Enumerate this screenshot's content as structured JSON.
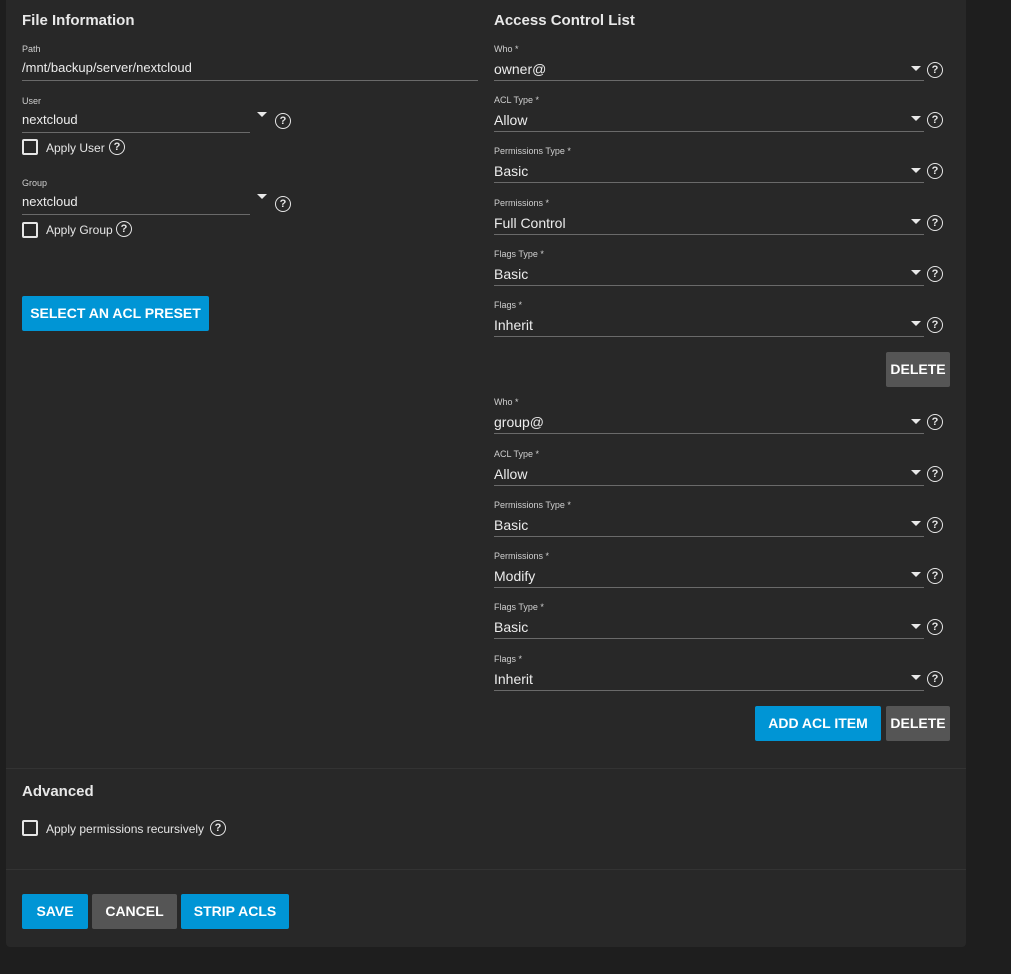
{
  "file_info": {
    "title": "File Information",
    "path_label": "Path",
    "path_value": "/mnt/backup/server/nextcloud",
    "user_label": "User",
    "user_value": "nextcloud",
    "apply_user_label": "Apply User",
    "group_label": "Group",
    "group_value": "nextcloud",
    "apply_group_label": "Apply Group",
    "preset_button": "SELECT AN ACL PRESET"
  },
  "acl": {
    "title": "Access Control List",
    "items": [
      {
        "who_label": "Who *",
        "who": "owner@",
        "acl_type_label": "ACL Type *",
        "acl_type": "Allow",
        "perm_type_label": "Permissions Type *",
        "perm_type": "Basic",
        "perms_label": "Permissions *",
        "perms": "Full Control",
        "flags_type_label": "Flags Type *",
        "flags_type": "Basic",
        "flags_label": "Flags *",
        "flags": "Inherit",
        "delete_label": "DELETE"
      },
      {
        "who_label": "Who *",
        "who": "group@",
        "acl_type_label": "ACL Type *",
        "acl_type": "Allow",
        "perm_type_label": "Permissions Type *",
        "perm_type": "Basic",
        "perms_label": "Permissions *",
        "perms": "Modify",
        "flags_type_label": "Flags Type *",
        "flags_type": "Basic",
        "flags_label": "Flags *",
        "flags": "Inherit",
        "delete_label": "DELETE"
      }
    ],
    "add_button": "ADD ACL ITEM"
  },
  "advanced": {
    "title": "Advanced",
    "recursive_label": "Apply permissions recursively"
  },
  "footer": {
    "save": "SAVE",
    "cancel": "CANCEL",
    "strip": "STRIP ACLS"
  },
  "help_glyph": "?",
  "colors": {
    "primary": "#0095d5",
    "secondary": "#555555",
    "card": "#282828",
    "page": "#1e1e1e"
  }
}
